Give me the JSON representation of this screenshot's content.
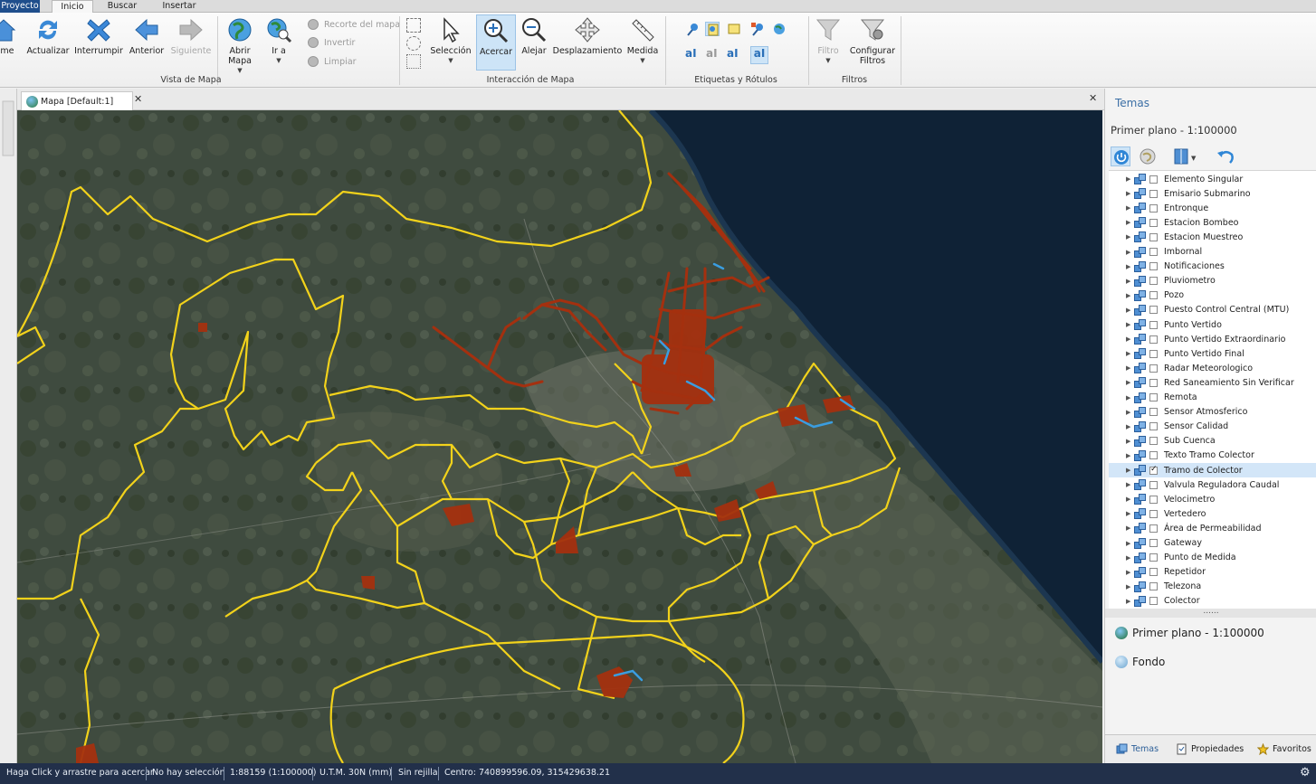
{
  "ribbon": {
    "tabs": [
      "Proyecto",
      "Inicio",
      "Buscar",
      "Insertar"
    ],
    "active_tab": "Inicio",
    "buttons": {
      "home": "ome",
      "refresh": "Actualizar",
      "stop": "Interrumpir",
      "back": "Anterior",
      "next": "Siguiente",
      "open_map": "Abrir\nMapa",
      "goto": "Ir a",
      "clip": "Recorte del mapa",
      "invert": "Invertir",
      "clear": "Limpiar",
      "select": "Selección",
      "zoom_in": "Acercar",
      "zoom_out": "Alejar",
      "pan": "Desplazamiento",
      "measure": "Medida",
      "filter": "Filtro",
      "config_filters": "Configurar\nFiltros"
    },
    "groups": {
      "map_view": "Vista de Mapa",
      "map_interaction": "Interacción de Mapa",
      "labels": "Etiquetas y Rótulos",
      "filters": "Filtros"
    }
  },
  "document": {
    "tab_label": "Mapa [Default:1]",
    "close_glyph": "✕"
  },
  "panel": {
    "title": "Temas",
    "scale_label": "Primer plano - 1:100000",
    "layers": [
      {
        "label": "Elemento Singular",
        "checked": false
      },
      {
        "label": "Emisario Submarino",
        "checked": false
      },
      {
        "label": "Entronque",
        "checked": false
      },
      {
        "label": "Estacion Bombeo",
        "checked": false
      },
      {
        "label": "Estacion Muestreo",
        "checked": false
      },
      {
        "label": "Imbornal",
        "checked": false
      },
      {
        "label": "Notificaciones",
        "checked": false
      },
      {
        "label": "Pluviometro",
        "checked": false
      },
      {
        "label": "Pozo",
        "checked": false
      },
      {
        "label": "Puesto Control Central (MTU)",
        "checked": false
      },
      {
        "label": "Punto Vertido",
        "checked": false
      },
      {
        "label": "Punto Vertido Extraordinario",
        "checked": false
      },
      {
        "label": "Punto Vertido Final",
        "checked": false
      },
      {
        "label": "Radar Meteorologico",
        "checked": false
      },
      {
        "label": "Red Saneamiento Sin Verificar",
        "checked": false
      },
      {
        "label": "Remota",
        "checked": false
      },
      {
        "label": "Sensor Atmosferico",
        "checked": false
      },
      {
        "label": "Sensor Calidad",
        "checked": false
      },
      {
        "label": "Sub Cuenca",
        "checked": false
      },
      {
        "label": "Texto Tramo Colector",
        "checked": false
      },
      {
        "label": "Tramo de Colector",
        "checked": true,
        "selected": true
      },
      {
        "label": "Valvula Reguladora Caudal",
        "checked": false
      },
      {
        "label": "Velocimetro",
        "checked": false
      },
      {
        "label": "Vertedero",
        "checked": false
      },
      {
        "label": "Área de Permeabilidad",
        "checked": false
      },
      {
        "label": "Gateway",
        "checked": false
      },
      {
        "label": "Punto de Medida",
        "checked": false
      },
      {
        "label": "Repetidor",
        "checked": false
      },
      {
        "label": "Telezona",
        "checked": false
      },
      {
        "label": "Colector",
        "checked": false
      }
    ],
    "grip": "......",
    "themes": [
      "Primer plano - 1:100000",
      "Fondo"
    ],
    "bottom_tabs": [
      "Temas",
      "Propiedades",
      "Favoritos"
    ]
  },
  "status": {
    "hint": "Haga Click y arrastre para acercar",
    "selection": "No hay selección",
    "scale": "1:88159 (1:100000)",
    "projection": "U.T.M. 30N (mm)",
    "grid": "Sin rejilla",
    "center": "Centro: 740899596.09, 315429638.21"
  },
  "colors": {
    "ribbon_file_tab": "#1f4e8c",
    "status_bar": "#22304a",
    "boundary_yellow": "#f2d21b",
    "network_red": "#a4300f",
    "network_blue": "#3a9de0",
    "sea": "#0f2236",
    "land": "#3d4a3e",
    "selection_highlight": "#d3e6f8"
  }
}
